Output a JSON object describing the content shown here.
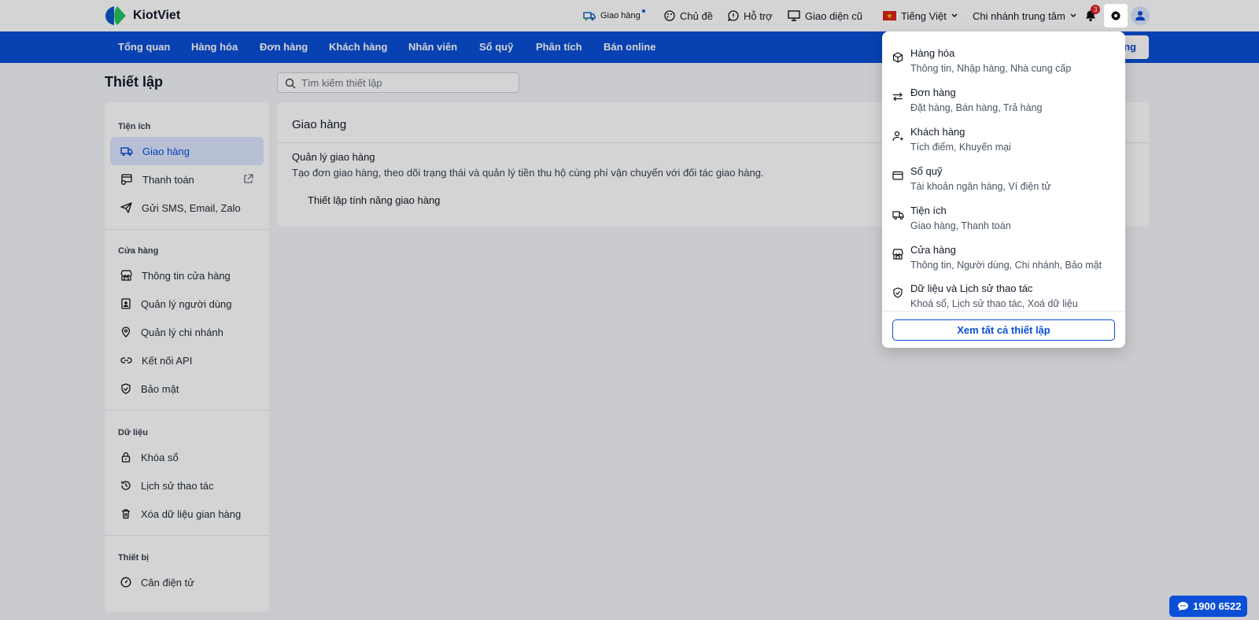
{
  "app": {
    "logo_text": "KiotViet"
  },
  "header": {
    "delivery": "Giao hàng",
    "theme": "Chủ đề",
    "support": "Hỗ trợ",
    "old_ui": "Giao diện cũ",
    "language": "Tiếng Việt",
    "branch": "Chi nhánh trung tâm",
    "notification_count": "3"
  },
  "nav": {
    "items": [
      "Tổng quan",
      "Hàng hóa",
      "Đơn hàng",
      "Khách hàng",
      "Nhân viên",
      "Sổ quỹ",
      "Phân tích",
      "Bán online"
    ],
    "sell_button": "ng"
  },
  "page": {
    "title": "Thiết lập",
    "search_placeholder": "Tìm kiếm thiết lập"
  },
  "sidebar": {
    "groups": [
      {
        "label": "Tiện ích",
        "items": [
          "Giao hàng",
          "Thanh toán",
          "Gửi SMS, Email, Zalo"
        ]
      },
      {
        "label": "Cửa hàng",
        "items": [
          "Thông tin cửa hàng",
          "Quản lý người dùng",
          "Quản lý chi nhánh",
          "Kết nối API",
          "Bảo mật"
        ]
      },
      {
        "label": "Dữ liệu",
        "items": [
          "Khóa sổ",
          "Lịch sử thao tác",
          "Xóa dữ liệu gian hàng"
        ]
      },
      {
        "label": "Thiết bị",
        "items": [
          "Cân điện tử"
        ]
      }
    ]
  },
  "content": {
    "title": "Giao hàng",
    "section_title": "Quản lý giao hàng",
    "section_desc": "Tạo đơn giao hàng, theo dõi trạng thái và quản lý tiền thu hộ cùng phí vận chuyển với đối tác giao hàng.",
    "link": "Thiết lập tính năng giao hàng"
  },
  "dropdown": {
    "items": [
      {
        "title": "Hàng hóa",
        "sub": "Thông tin, Nhập hàng, Nhà cung cấp",
        "icon": "box-icon"
      },
      {
        "title": "Đơn hàng",
        "sub": "Đặt hàng, Bán hàng, Trả hàng",
        "icon": "swap-icon"
      },
      {
        "title": "Khách hàng",
        "sub": "Tích điểm, Khuyến mại",
        "icon": "user-icon"
      },
      {
        "title": "Sổ quỹ",
        "sub": "Tài khoản ngân hàng, Ví điện tử",
        "icon": "wallet-icon"
      },
      {
        "title": "Tiện ích",
        "sub": "Giao hàng, Thanh toán",
        "icon": "truck-icon"
      },
      {
        "title": "Cửa hàng",
        "sub": "Thông tin, Người dùng, Chi nhánh, Bảo mật",
        "icon": "store-icon"
      },
      {
        "title": "Dữ liệu và Lịch sử thao tác",
        "sub": "Khoá sổ, Lịch sử thao tác, Xoá dữ liệu",
        "icon": "shield-icon"
      }
    ],
    "view_all": "Xem tất cả thiết lập"
  },
  "hotline": "1900 6522",
  "colors": {
    "brand_blue": "#0a4fd6",
    "badge_red": "#e11d2a"
  }
}
